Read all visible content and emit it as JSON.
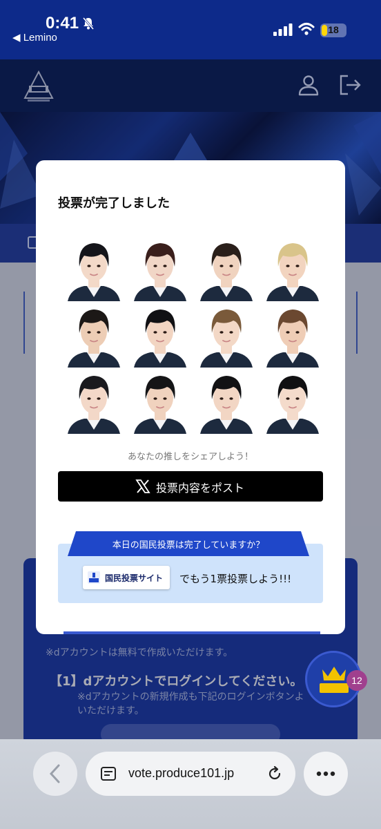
{
  "status_bar": {
    "time": "0:41",
    "back_app": "◀ Lemino",
    "battery": "18"
  },
  "header": {
    "logo_text": "PRODUCE 101"
  },
  "modal": {
    "title": "投票が完了しました",
    "share_prompt": "あなたの推しをシェアしよう！",
    "post_button": "投票内容をポスト",
    "ribbon_text": "本日の国民投票は完了していますか？",
    "site_button": "国民投票サイト",
    "vote_more": "でもう1票投票しよう!!!"
  },
  "faces": [
    {
      "hair": "#15151a",
      "skin": "#f3d9c8"
    },
    {
      "hair": "#3a1f1c",
      "skin": "#f1d6c6"
    },
    {
      "hair": "#2a1f1a",
      "skin": "#f0d3bf"
    },
    {
      "hair": "#d9c48a",
      "skin": "#f2d4bf"
    },
    {
      "hair": "#1c1816",
      "skin": "#edcdb5"
    },
    {
      "hair": "#111114",
      "skin": "#f2d5c2"
    },
    {
      "hair": "#7a5a3a",
      "skin": "#f3d8c6"
    },
    {
      "hair": "#6b4830",
      "skin": "#efcdb6"
    },
    {
      "hair": "#1a1a1e",
      "skin": "#f3d8c8"
    },
    {
      "hair": "#151517",
      "skin": "#f0d2be"
    },
    {
      "hair": "#121214",
      "skin": "#f2d6c4"
    },
    {
      "hair": "#101012",
      "skin": "#f4dbcb"
    }
  ],
  "background_page": {
    "note": "※dアカウントは無料で作成いただけます。",
    "step": "【1】dアカウントでログインしてください。",
    "sub_line1": "※dアカウントの新規作成も下記のログインボタンより",
    "sub_line2": "いただけます。",
    "badge_count": "12"
  },
  "browser": {
    "url": "vote.produce101.jp"
  },
  "colors": {
    "status_bg": "#0d2a8a",
    "header_bg": "#0c1f57",
    "ribbon": "#1f47c9",
    "infobox": "#cfe3fb"
  }
}
